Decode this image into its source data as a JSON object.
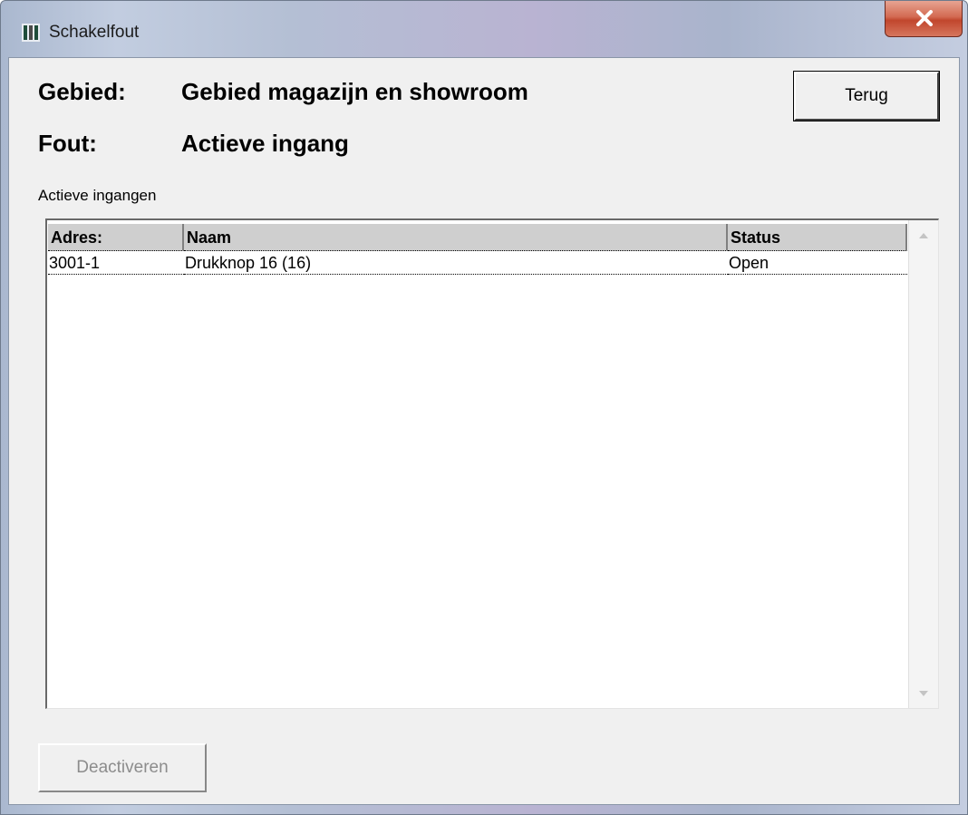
{
  "window": {
    "title": "Schakelfout",
    "close_icon": "close-x-icon",
    "app_icon": "app-icon"
  },
  "info": {
    "area_label": "Gebied:",
    "area_value": "Gebied magazijn en showroom",
    "fault_label": "Fout:",
    "fault_value": "Actieve ingang"
  },
  "buttons": {
    "back": "Terug",
    "deactivate": "Deactiveren",
    "deactivate_enabled": false
  },
  "list": {
    "caption": "Actieve ingangen",
    "columns": [
      "Adres:",
      "Naam",
      "Status"
    ],
    "rows": [
      [
        "3001-1",
        "Drukknop 16 (16)",
        "Open"
      ]
    ]
  }
}
